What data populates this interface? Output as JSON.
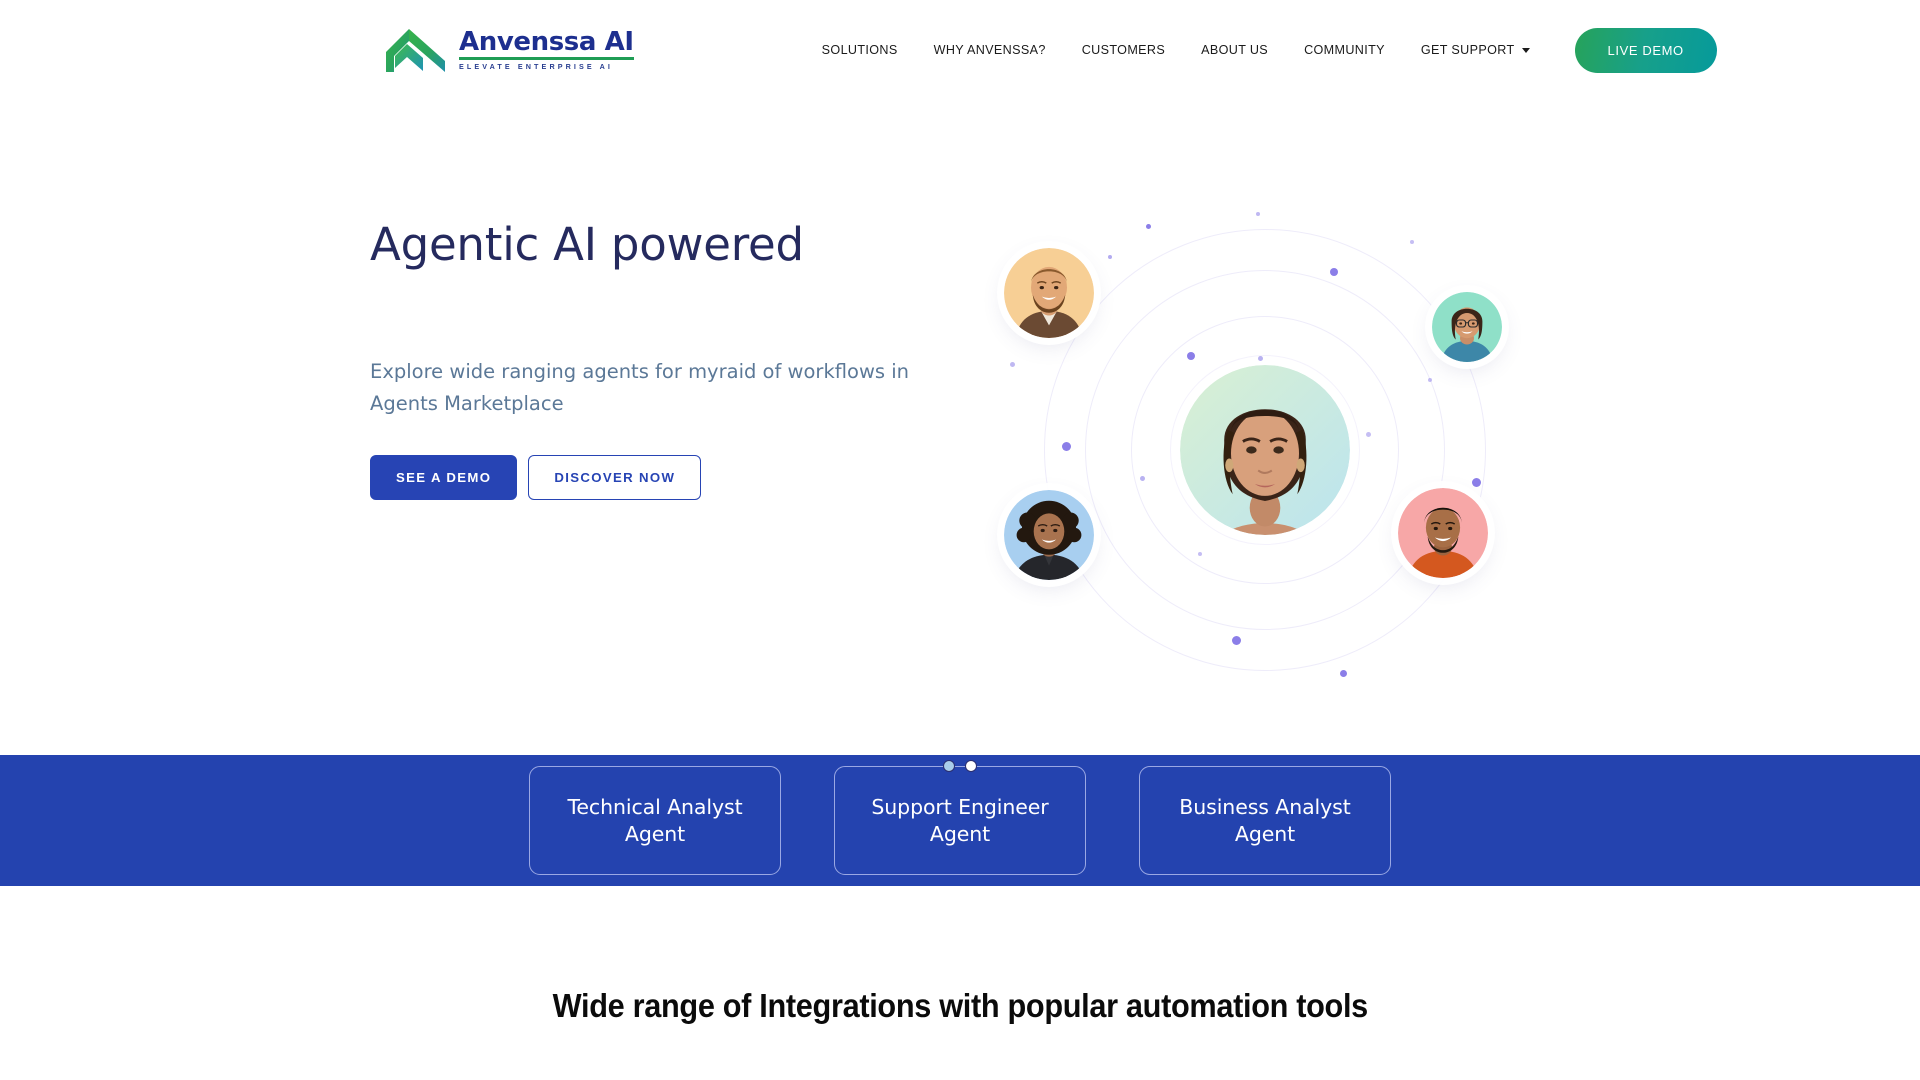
{
  "brand": {
    "name": "Anvenssa AI",
    "tagline": "ELEVATE ENTERPRISE AI",
    "logo_icon": "chevron-mark-icon",
    "green": "#1f9d55",
    "navy": "#1d2f8f"
  },
  "nav": {
    "items": [
      {
        "label": "SOLUTIONS",
        "has_dropdown": false
      },
      {
        "label": "WHY ANVENSSA?",
        "has_dropdown": false
      },
      {
        "label": "CUSTOMERS",
        "has_dropdown": false
      },
      {
        "label": "ABOUT US",
        "has_dropdown": false
      },
      {
        "label": "COMMUNITY",
        "has_dropdown": false
      },
      {
        "label": "GET SUPPORT",
        "has_dropdown": true
      }
    ],
    "cta": {
      "label": "LIVE DEMO",
      "color_start": "#27a35a",
      "color_end": "#069a9b"
    }
  },
  "hero": {
    "title": "Agentic AI powered",
    "subtitle": "Explore wide ranging agents for myraid of workflows in Agents Marketplace",
    "primary_button": "SEE A DEMO",
    "secondary_button": "DISCOVER NOW",
    "accent": "#2744b4",
    "title_color": "#252a5e",
    "subtitle_color": "#5b7897"
  },
  "illustration": {
    "name": "orbiting-avatars-graphic",
    "center_avatar": {
      "name": "center-avatar",
      "bg_start": "#d6efd4",
      "bg_end": "#bfe5ef"
    },
    "orbit_avatars": [
      {
        "name": "avatar-top-left",
        "bg": "#f7cf95"
      },
      {
        "name": "avatar-top-right",
        "bg": "#8fe0c8"
      },
      {
        "name": "avatar-bottom-left",
        "bg": "#a8cff0"
      },
      {
        "name": "avatar-bottom-right",
        "bg": "#f7a7a7"
      }
    ],
    "ring_color": "#eeecfa",
    "dot_color": "#8b7ee8"
  },
  "carousel": {
    "slides": 2,
    "active_index": 0,
    "active_color": "#a8cdea",
    "border_color": "#2b2f70"
  },
  "band": {
    "background": "#2443af",
    "border_color": "#9aa8e4",
    "cards": [
      {
        "label": "Technical Analyst Agent"
      },
      {
        "label": "Support Engineer Agent"
      },
      {
        "label": "Business Analyst Agent"
      }
    ]
  },
  "integrations": {
    "heading": "Wide range of Integrations with popular automation tools"
  }
}
